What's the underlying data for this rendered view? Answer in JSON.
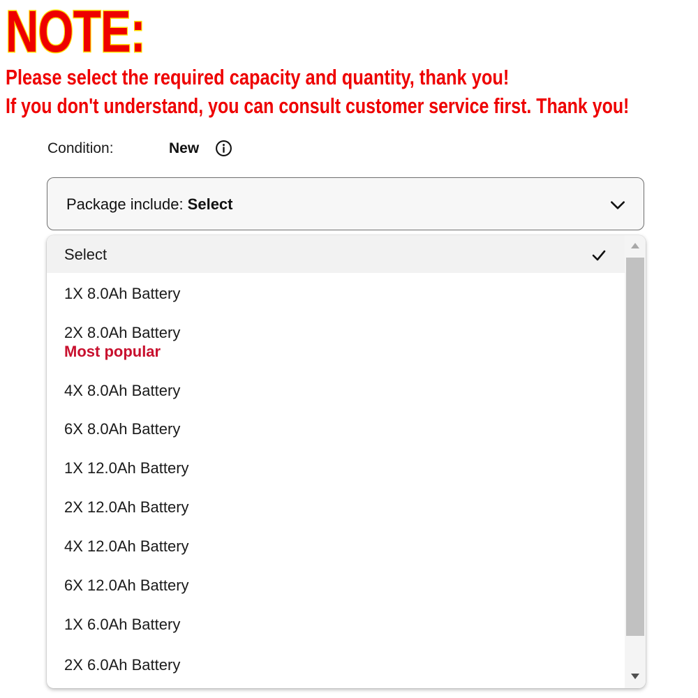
{
  "note": {
    "title": "NOTE:",
    "line1": "Please select the required capacity and quantity, thank you!",
    "line2": "If you don't understand, you can consult customer service first. Thank you!"
  },
  "condition": {
    "label": "Condition:",
    "value": "New",
    "info_icon": "info-circle-icon"
  },
  "select": {
    "label": "Package include: ",
    "value": "Select",
    "chevron_icon": "chevron-down-icon"
  },
  "options": [
    {
      "label": "Select",
      "selected": true
    },
    {
      "label": "1X 8.0Ah Battery"
    },
    {
      "label": "2X 8.0Ah Battery",
      "badge": "Most popular"
    },
    {
      "label": "4X 8.0Ah Battery"
    },
    {
      "label": "6X 8.0Ah Battery"
    },
    {
      "label": "1X 12.0Ah Battery"
    },
    {
      "label": "2X 12.0Ah Battery"
    },
    {
      "label": "4X 12.0Ah Battery"
    },
    {
      "label": "6X 12.0Ah Battery"
    },
    {
      "label": "1X 6.0Ah Battery"
    },
    {
      "label": "2X 6.0Ah Battery"
    }
  ],
  "colors": {
    "note_text": "#ee0000",
    "note_outline": "#ffe000",
    "badge": "#c8102e"
  }
}
